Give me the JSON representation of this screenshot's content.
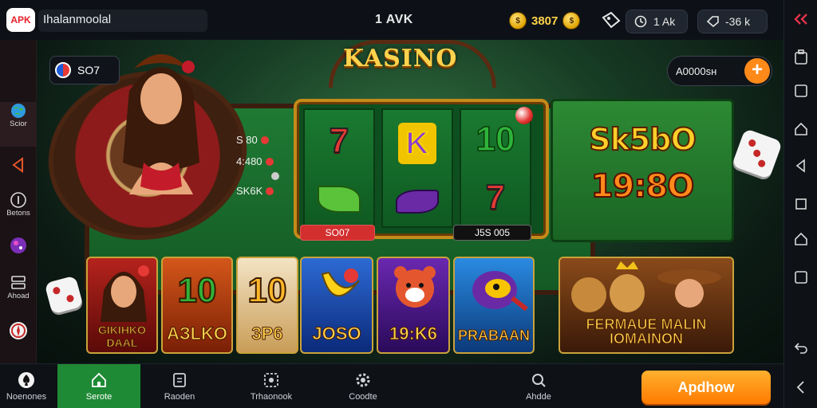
{
  "topbar": {
    "app_badge": "APK",
    "app_name": "Ihalanmoolal",
    "title": "1 AVK",
    "coins": "3807",
    "coin_symbol": "$",
    "time": "1 Ak",
    "balance": "-36 k"
  },
  "left_rail": {
    "items": [
      {
        "icon": "globe-icon",
        "label": "Scior"
      },
      {
        "icon": "triangle-left-icon",
        "label": ""
      },
      {
        "icon": "info-icon",
        "label": "Betons"
      },
      {
        "icon": "ball-icon",
        "label": ""
      },
      {
        "icon": "grid-icon",
        "label": "Ahoad"
      },
      {
        "icon": "compass-icon",
        "label": ""
      }
    ]
  },
  "stage": {
    "chip_badge": "SO7",
    "logo": "KASINO",
    "bets": [
      {
        "label": "S 80",
        "color": "#e53935"
      },
      {
        "label": "4:480",
        "color": "#e53935"
      },
      {
        "label": "",
        "color": "#cccccc"
      },
      {
        "label": "SK6K",
        "color": "#e53935"
      }
    ],
    "slot": {
      "reels": [
        {
          "top": "7",
          "bottom": "leaf"
        },
        {
          "top": "K",
          "bottom": "eggplant"
        },
        {
          "top": "10",
          "bottom": "7"
        }
      ],
      "left_label": "SO07",
      "right_label": "J5S 005"
    },
    "promo": {
      "line1": "Sk5bO",
      "line2": "19:8O"
    },
    "cta_chip": "A0000sн"
  },
  "cards": [
    {
      "big": "",
      "label": "GIKIHKO DAAL",
      "bg1": "#b5231c",
      "bg2": "#5a0a08"
    },
    {
      "big": "10",
      "label": "AЗLKO",
      "bg1": "#d4571a",
      "bg2": "#7a1f05",
      "big_color": "#2fb33a"
    },
    {
      "big": "10",
      "label": "3P6",
      "bg1": "#f3e3c4",
      "bg2": "#c99d57",
      "big_color": "#ffb72a"
    },
    {
      "big": "",
      "label": "JOSO",
      "bg1": "#2d6ad4",
      "bg2": "#0b2a7a"
    },
    {
      "big": "",
      "label": "19:K6",
      "bg1": "#6a28b0",
      "bg2": "#2a0a5a"
    },
    {
      "big": "",
      "label": "PRABAAN",
      "bg1": "#2a8ae0",
      "bg2": "#0b3a7a"
    },
    {
      "big": "",
      "label": "FERMAUE MALIN IOMAINON",
      "bg1": "#8a4a1a",
      "bg2": "#3a1a08"
    }
  ],
  "bottom": {
    "tabs": [
      {
        "icon": "spade-icon",
        "label": "Noenones"
      },
      {
        "icon": "home-icon",
        "label": "Serote"
      },
      {
        "icon": "document-icon",
        "label": "Raoden"
      },
      {
        "icon": "dashed-box-icon",
        "label": "Trhaonook"
      },
      {
        "icon": "settings-icon",
        "label": "Coodte"
      },
      {
        "icon": "search-icon",
        "label": "Ahdde"
      }
    ],
    "apply_label": "Apdhow"
  }
}
